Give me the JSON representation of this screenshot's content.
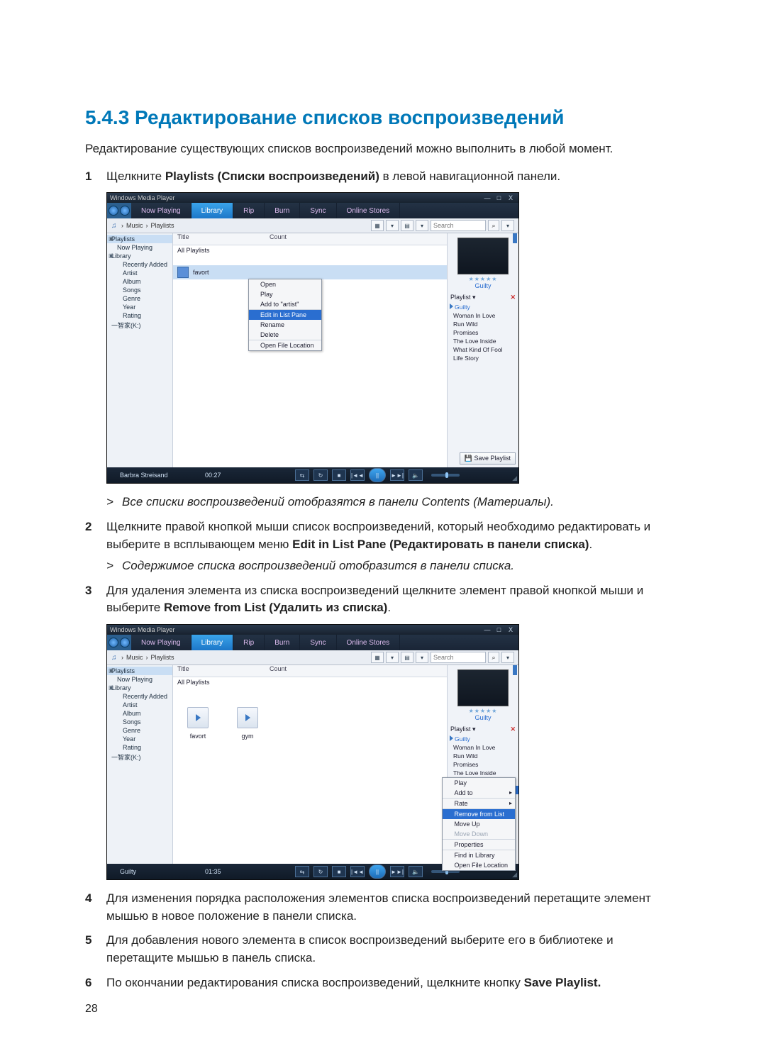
{
  "heading": "5.4.3 Редактирование списков воспроизведений",
  "intro": "Редактирование существующих списков воспроизведений можно выполнить в любой момент.",
  "steps": {
    "one": {
      "num": "1",
      "pre": "Щелкните ",
      "bold": "Playlists (Списки воспроизведений)",
      "post": " в левой навигационной панели."
    },
    "two": {
      "num": "2",
      "line1": "Щелкните правой кнопкой мыши список воспроизведений, который необходимо редактировать и выберите в всплывающем меню ",
      "bold1": "Edit in List Pane (Редактировать в панели списка)",
      "tail1": "."
    },
    "three": {
      "num": "3",
      "pre": "Для удаления элемента из списка воспроизведений щелкните элемент правой кнопкой мыши и выберите ",
      "bold": "Remove from List (Удалить из списка)",
      "tail": "."
    },
    "four": {
      "num": "4",
      "text": "Для изменения порядка расположения элементов списка воспроизведений перетащите элемент мышью в новое положение в панели списка."
    },
    "five": {
      "num": "5",
      "text": "Для добавления нового элемента в список воспроизведений выберите его в библиотеке и перетащите мышью в панель списка."
    },
    "six": {
      "num": "6",
      "pre": "По окончании редактирования списка воспроизведений, щелкните кнопку ",
      "bold": "Save Playlist."
    }
  },
  "results": {
    "r1": "Все списки воспроизведений отобразятся в панели Contents (Материалы).",
    "r2": "Содержимое списка воспроизведений отобразится в панели списка."
  },
  "page_num": "28",
  "wmp": {
    "title": "Windows Media Player",
    "winbtns": {
      "min": "—",
      "max": "□",
      "close": "X"
    },
    "tabs": {
      "now_playing": "Now Playing",
      "library": "Library",
      "rip": "Rip",
      "burn": "Burn",
      "sync": "Sync",
      "online_stores": "Online Stores"
    },
    "breadcrumb": {
      "music": "Music",
      "playlists": "Playlists",
      "sep": "›"
    },
    "search": {
      "placeholder": "Search",
      "drop": "▾",
      "mag": "🔍"
    },
    "nav": {
      "playlists": "Playlists",
      "now_playing": "Now Playing",
      "library": "Library",
      "recently_added": "Recently Added",
      "artist": "Artist",
      "album": "Album",
      "songs": "Songs",
      "genre": "Genre",
      "year": "Year",
      "rating": "Rating",
      "other": "一智家(K:)"
    },
    "cols": {
      "title": "Title",
      "count": "Count"
    },
    "rows": {
      "all_playlists": "All Playlists",
      "favort": "favort",
      "gym": "gym"
    },
    "ctx_menu": {
      "open": "Open",
      "play": "Play",
      "add_to": "Add to \"artist\"",
      "edit_in_list_pane": "Edit in List Pane",
      "rename": "Rename",
      "delete": "Delete",
      "open_file_location": "Open File Location"
    },
    "rpane": {
      "stars": "★★★★★",
      "album": "Guilty",
      "label": "Playlist",
      "close": "✕",
      "tracks": {
        "t0": "Guilty",
        "t1": "Woman In Love",
        "t2": "Run Wild",
        "t3": "Promises",
        "t4": "The Love Inside",
        "t5": "What Kind Of Fool",
        "t6": "Life Story"
      },
      "save": "Save Playlist"
    },
    "rctx": {
      "play": "Play",
      "add_to": "Add to",
      "rate": "Rate",
      "remove": "Remove from List",
      "move_up": "Move Up",
      "move_down": "Move Down",
      "properties": "Properties",
      "find_in_library": "Find in Library",
      "open_file_location": "Open File Location"
    },
    "playbar": {
      "np1": "Barbra Streisand",
      "time1": "00:27",
      "np2": "Guilty",
      "time2": "01:35",
      "shuffle": "⇆",
      "repeat": "↻",
      "stop": "■",
      "prev": "|◄◄",
      "play": "||",
      "next": "►►|",
      "mute": "🔈"
    }
  }
}
